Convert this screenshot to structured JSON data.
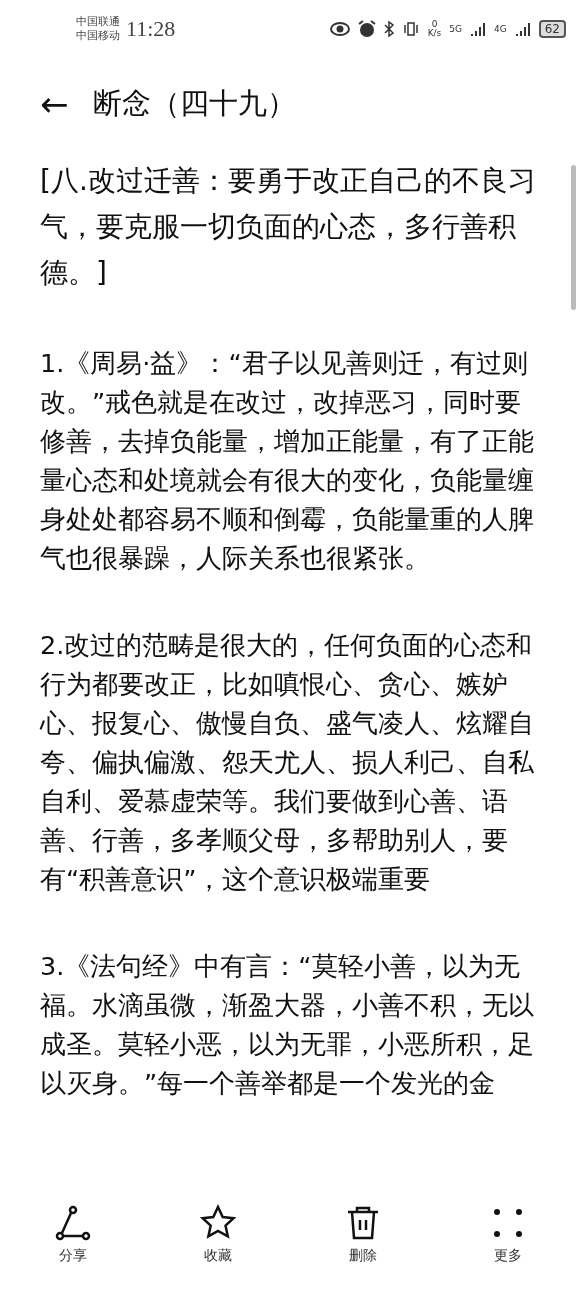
{
  "status_bar": {
    "carriers": [
      "中国联通",
      "中国移动"
    ],
    "time": "11:28",
    "speed_value": "0",
    "speed_unit": "K/s",
    "network_1": "5G",
    "network_2": "4G",
    "battery": "62"
  },
  "header": {
    "back": "←",
    "title": "断念（四十九）"
  },
  "heading": "[八.改过迁善：要勇于改正自己的不良习气，要克服一切负面的心态，多行善积德。]",
  "paragraphs": [
    "1.《周易·益》：“君子以见善则迁，有过则改。”戒色就是在改过，改掉恶习，同时要修善，去掉负能量，增加正能量，有了正能量心态和处境就会有很大的变化，负能量缠身处处都容易不顺和倒霉，负能量重的人脾气也很暴躁，人际关系也很紧张。",
    "2.改过的范畴是很大的，任何负面的心态和行为都要改正，比如嗔恨心、贪心、嫉妒心、报复心、傲慢自负、盛气凌人、炫耀自夸、偏执偏激、怨天尤人、损人利己、自私自利、爱慕虚荣等。我们要做到心善、语善、行善，多孝顺父母，多帮助别人，要有“积善意识”，这个意识极端重要",
    "3.《法句经》中有言：“莫轻小善，以为无福。水滴虽微，渐盈大器，小善不积，无以成圣。莫轻小恶，以为无罪，小恶所积，足以灭身。”每一个善举都是一个发光的金"
  ],
  "toolbar": [
    {
      "kind": "share",
      "label": "分享"
    },
    {
      "kind": "star",
      "label": "收藏"
    },
    {
      "kind": "trash",
      "label": "删除"
    },
    {
      "kind": "more",
      "label": "更多"
    }
  ]
}
